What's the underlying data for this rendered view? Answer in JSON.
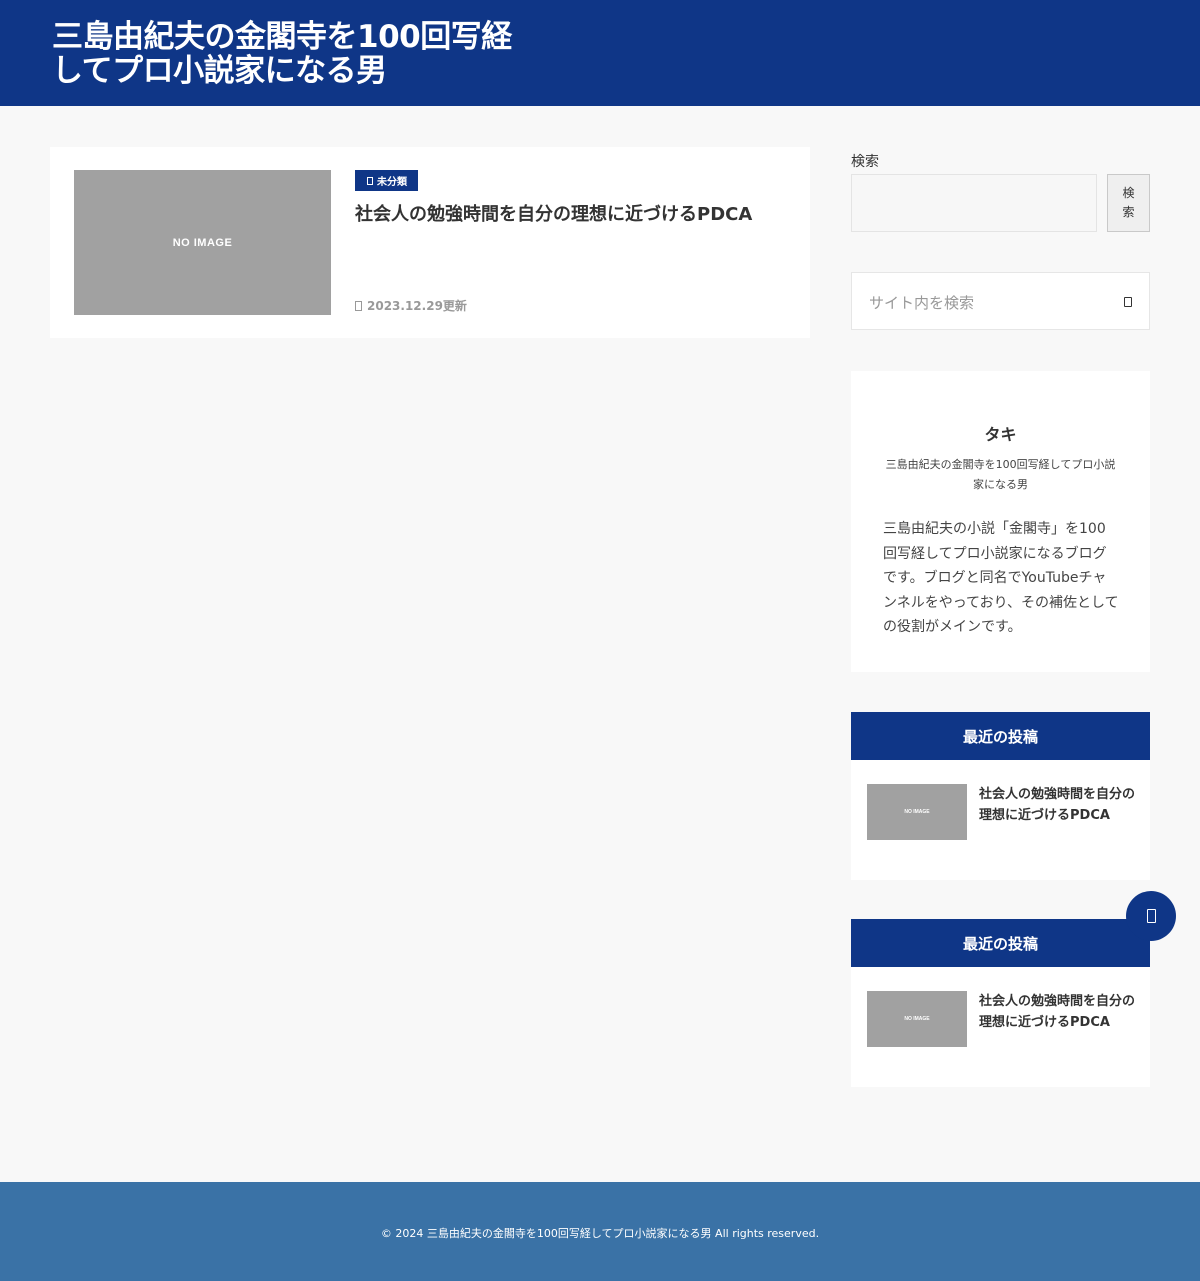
{
  "header": {
    "site_title_line1": "三島由紀夫の金閣寺を100回写経",
    "site_title_line2": "してプロ小説家になる男"
  },
  "main": {
    "post": {
      "image_text": "NO IMAGE",
      "category": "未分類",
      "title": "社会人の勉強時間を自分の理想に近づけるPDCA",
      "date": "2023.12.29更新"
    }
  },
  "sidebar": {
    "search": {
      "label": "検索",
      "input_value": "",
      "button_label": "検索"
    },
    "site_search": {
      "placeholder": "サイト内を検索"
    },
    "profile": {
      "name": "タキ",
      "tagline": "三島由紀夫の金閣寺を100回写経してプロ小説家になる男",
      "bio": "三島由紀夫の小説「金閣寺」を100回写経してプロ小説家になるブログです。ブログと同名でYouTubeチャンネルをやっており、その補佐としての役割がメインです。"
    },
    "recent_posts_1": {
      "heading": "最近の投稿",
      "items": [
        {
          "image_text": "NO IMAGE",
          "title": "社会人の勉強時間を自分の理想に近づけるPDCA"
        }
      ]
    },
    "recent_posts_2": {
      "heading": "最近の投稿",
      "items": [
        {
          "image_text": "NO IMAGE",
          "title": "社会人の勉強時間を自分の理想に近づけるPDCA"
        }
      ]
    }
  },
  "footer": {
    "copyright": "© 2024 三島由紀夫の金閣寺を100回写経してプロ小説家になる男 All rights reserved."
  },
  "colors": {
    "brand": "#0f3687",
    "footer": "#3a72a6",
    "background": "#f8f8f8",
    "placeholder_image": "#a1a1a1"
  },
  "icons": {
    "category": "folder-icon",
    "date": "clock-icon",
    "site_search": "search-icon",
    "fab": "scroll-top-icon"
  }
}
